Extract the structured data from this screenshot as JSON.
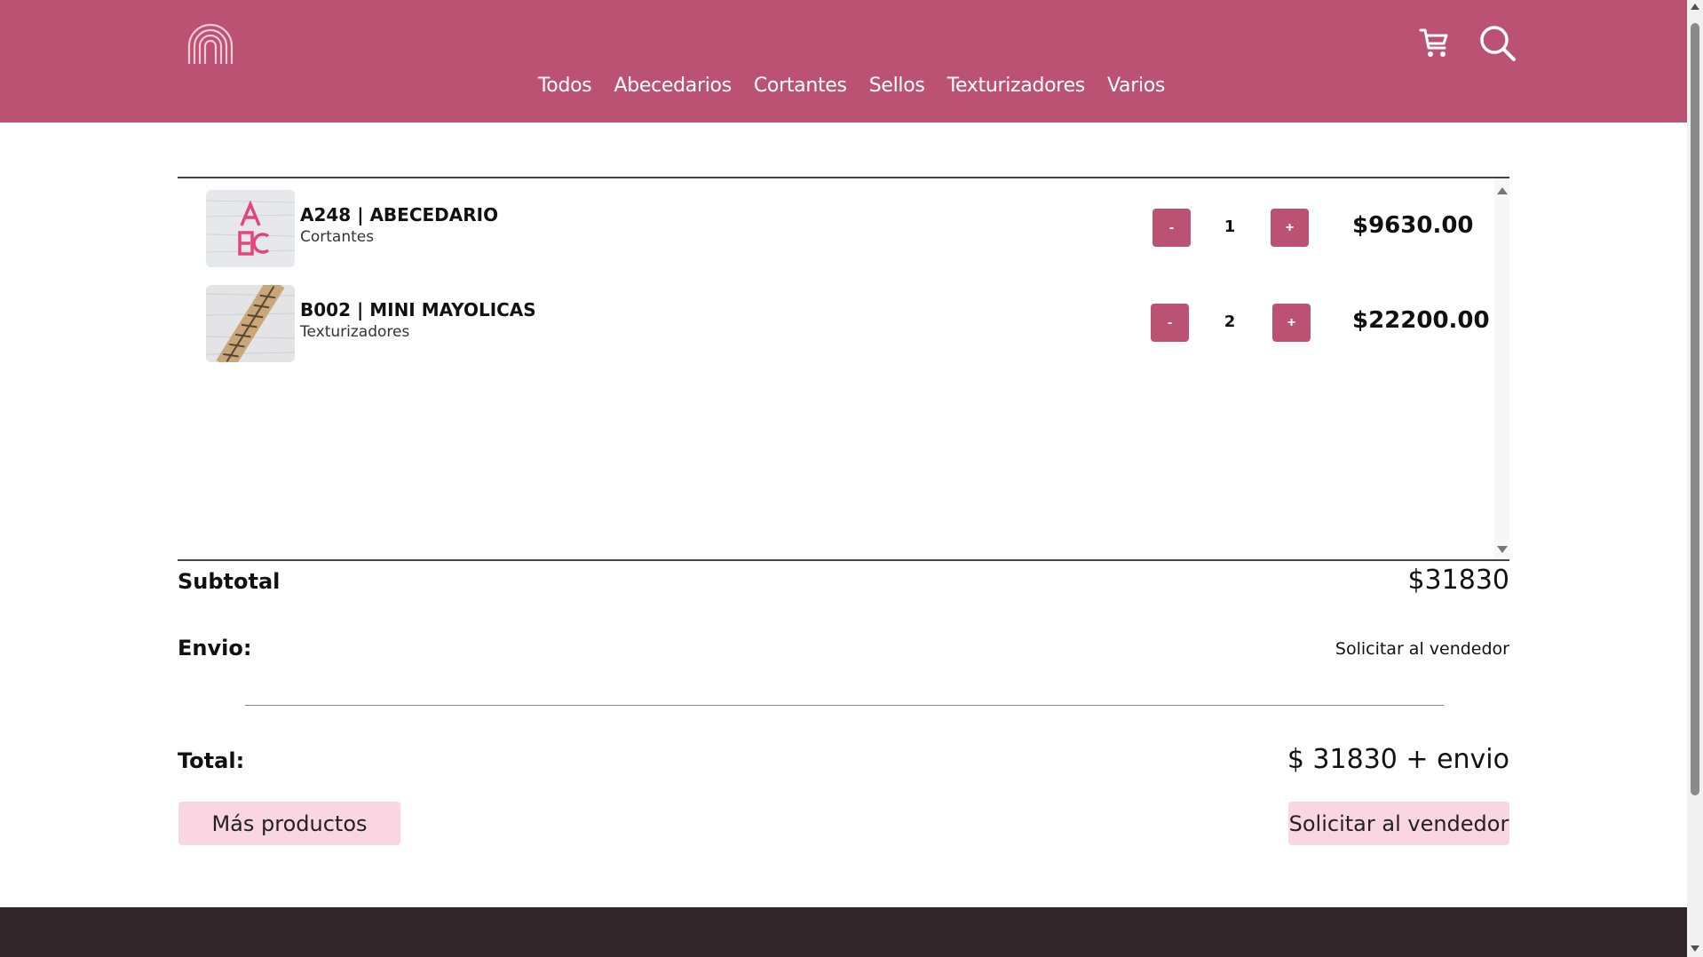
{
  "brand": {
    "accent": "#bc5273",
    "button_light": "#fad6e2",
    "footer": "#302528"
  },
  "header": {
    "logo_icon": "rainbow-icon",
    "nav": [
      "Todos",
      "Abecedarios",
      "Cortantes",
      "Sellos",
      "Texturizadores",
      "Varios"
    ],
    "cart_icon": "cart-icon",
    "search_icon": "search-icon"
  },
  "cart": {
    "items": [
      {
        "title": "A248 | ABECEDARIO",
        "category": "Cortantes",
        "minus": "-",
        "quantity": "1",
        "plus": "+",
        "price": "$9630.00"
      },
      {
        "title": "B002 | MINI MAYOLICAS",
        "category": "Texturizadores",
        "minus": "-",
        "quantity": "2",
        "plus": "+",
        "price": "$22200.00"
      }
    ]
  },
  "summary": {
    "subtotal_label": "Subtotal",
    "subtotal_value": "$31830",
    "shipping_label": "Envio:",
    "shipping_value": "Solicitar al vendedor",
    "total_label": "Total:",
    "total_value": "$ 31830 + envio"
  },
  "actions": {
    "more_products": "Más productos",
    "request_seller": "Solicitar al vendedor"
  }
}
